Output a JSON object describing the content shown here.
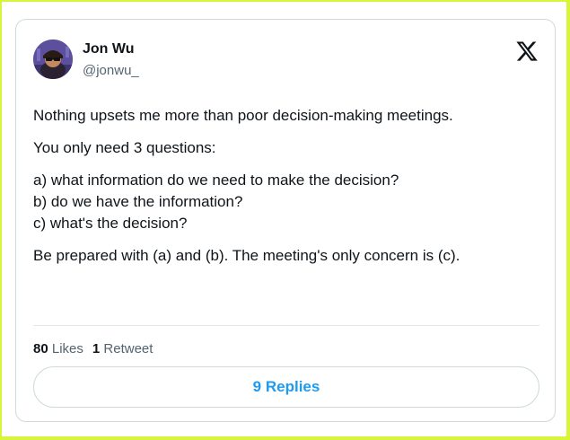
{
  "author": {
    "name": "Jon Wu",
    "handle": "@jonwu_"
  },
  "logo_icon": "x-logo-icon",
  "tweet": {
    "paragraphs": [
      [
        "Nothing upsets me more than poor decision-making meetings."
      ],
      [
        "You only need 3 questions:"
      ],
      [
        "a) what information do we need to make the decision?",
        "b) do we have the information?",
        "c) what's the decision?"
      ],
      [
        "Be prepared with (a) and (b). The meeting's only concern is (c)."
      ]
    ]
  },
  "stats": {
    "likes_count": "80",
    "likes_label": "Likes",
    "retweets_count": "1",
    "retweets_label": "Retweet"
  },
  "replies_button": {
    "label": "9 Replies"
  },
  "colors": {
    "background": "#d8f53a",
    "accent": "#1d9bf0",
    "text": "#0f1419",
    "muted": "#536471"
  }
}
